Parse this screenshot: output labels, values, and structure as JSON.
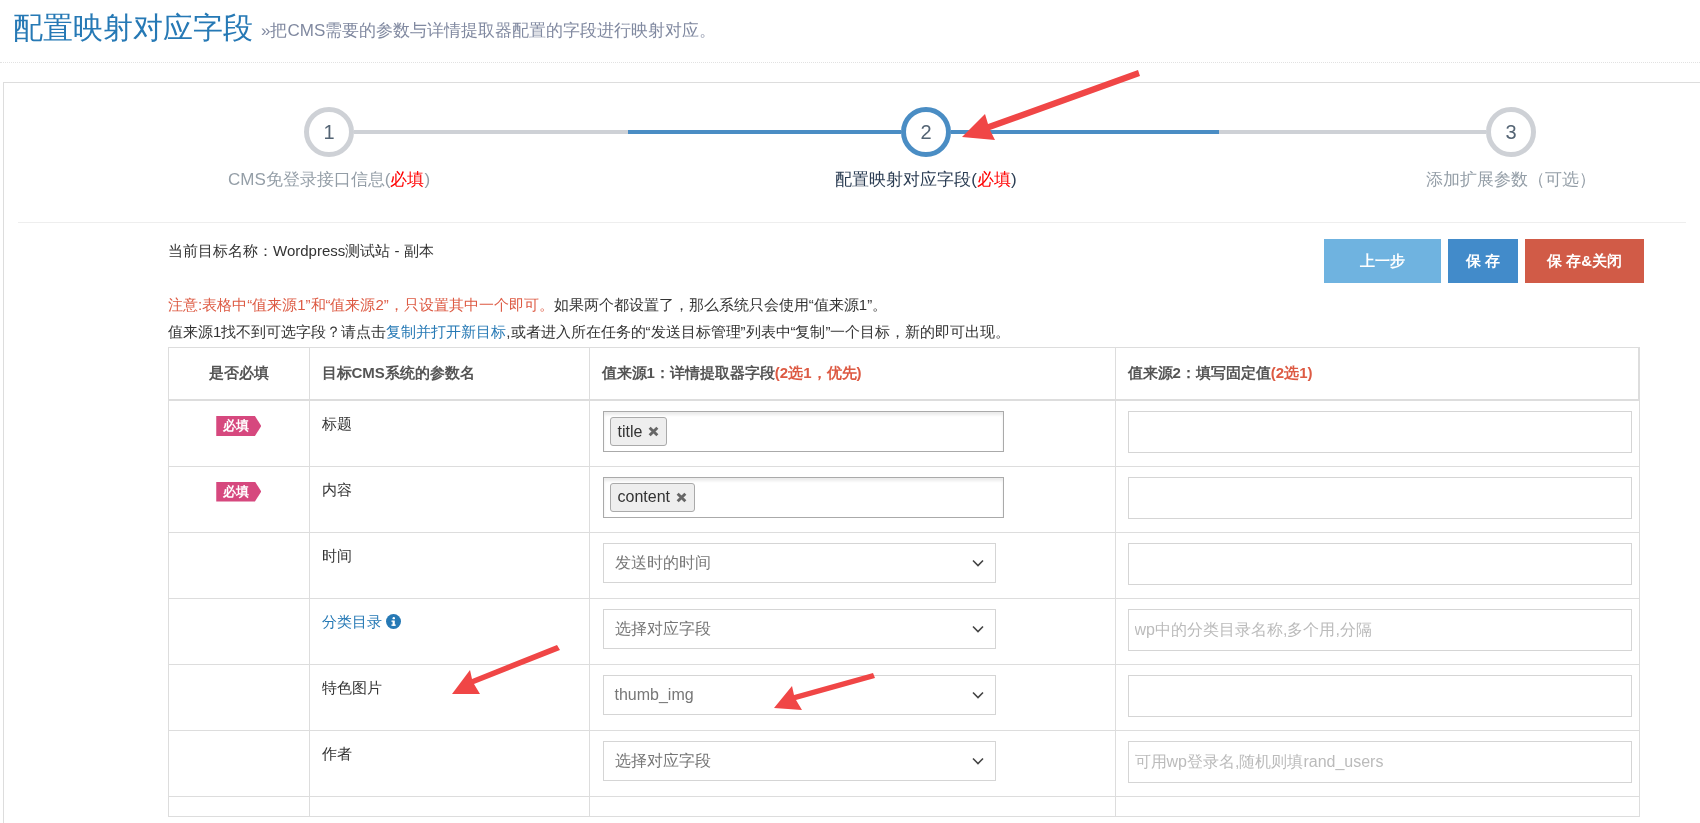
{
  "page_title": "配置映射对应字段",
  "page_subtitle": "»把CMS需要的参数与详情提取器配置的字段进行映射对应。",
  "steps": [
    {
      "number": "1",
      "selected": false,
      "parts": [
        {
          "text": "CMS免登录接口信息(",
          "kind": "plain"
        },
        {
          "text": "必填",
          "kind": "required"
        },
        {
          "text": ")",
          "kind": "plain"
        }
      ]
    },
    {
      "number": "2",
      "selected": true,
      "parts": [
        {
          "text": "配置映射对应字段(",
          "kind": "plain"
        },
        {
          "text": "必填",
          "kind": "required"
        },
        {
          "text": ")",
          "kind": "plain"
        }
      ]
    },
    {
      "number": "3",
      "selected": false,
      "parts": [
        {
          "text": "添加扩展参数（可选）",
          "kind": "plain"
        }
      ]
    }
  ],
  "target_name": "当前目标名称：Wordpress测试站 - 副本",
  "buttons": [
    {
      "label": "上一步",
      "kind": "prev"
    },
    {
      "label": "保 存",
      "kind": "save"
    },
    {
      "label": "保 存&关闭",
      "kind": "save-close"
    }
  ],
  "notices": [
    {
      "parts": [
        {
          "text": "注意:表格中“值来源1”和“值来源2”，只设置其中一个即可。",
          "kind": "warning"
        },
        {
          "text": "如果两个都设置了，那么系统只会使用“值来源1”。",
          "kind": "plain"
        }
      ]
    },
    {
      "parts": [
        {
          "text": "值来源1找不到可选字段？请点击",
          "kind": "plain"
        },
        {
          "text": "复制并打开新目标",
          "kind": "link"
        },
        {
          "text": ",或者进入所在任务的“发送目标管理”列表中“复制”一个目标，新的即可出现。",
          "kind": "plain"
        }
      ]
    }
  ],
  "table": {
    "columns": [
      {
        "parts": [
          {
            "text": "是否必填",
            "kind": "plain"
          }
        ]
      },
      {
        "parts": [
          {
            "text": "目标CMS系统的参数名",
            "kind": "plain"
          }
        ]
      },
      {
        "parts": [
          {
            "text": "值来源1：详情提取器字段",
            "kind": "plain"
          },
          {
            "text": "(2选1，优先)",
            "kind": "warning"
          }
        ]
      },
      {
        "parts": [
          {
            "text": "值来源2：填写固定值",
            "kind": "plain"
          },
          {
            "text": "(2选1)",
            "kind": "warning"
          }
        ]
      }
    ],
    "rows": [
      {
        "required": "必填",
        "param": "标题",
        "link": false,
        "source1": {
          "kind": "tags",
          "tags": [
            "title"
          ]
        },
        "source2": {}
      },
      {
        "required": "必填",
        "param": "内容",
        "link": false,
        "source1": {
          "kind": "tags",
          "tags": [
            "content"
          ]
        },
        "source2": {}
      },
      {
        "param": "时间",
        "link": false,
        "source1": {
          "kind": "select",
          "value": "发送时的时间"
        },
        "source2": {}
      },
      {
        "param": "分类目录",
        "link": true,
        "source1": {
          "kind": "select",
          "value": "选择对应字段"
        },
        "source2": {
          "placeholder": "wp中的分类目录名称,多个用,分隔"
        }
      },
      {
        "param": "特色图片",
        "link": false,
        "source1": {
          "kind": "select",
          "value": "thumb_img"
        },
        "source2": {}
      },
      {
        "param": "作者",
        "link": false,
        "source1": {
          "kind": "select",
          "value": "选择对应字段"
        },
        "source2": {
          "placeholder": "可用wp登录名,随机则填rand_users"
        }
      }
    ]
  }
}
